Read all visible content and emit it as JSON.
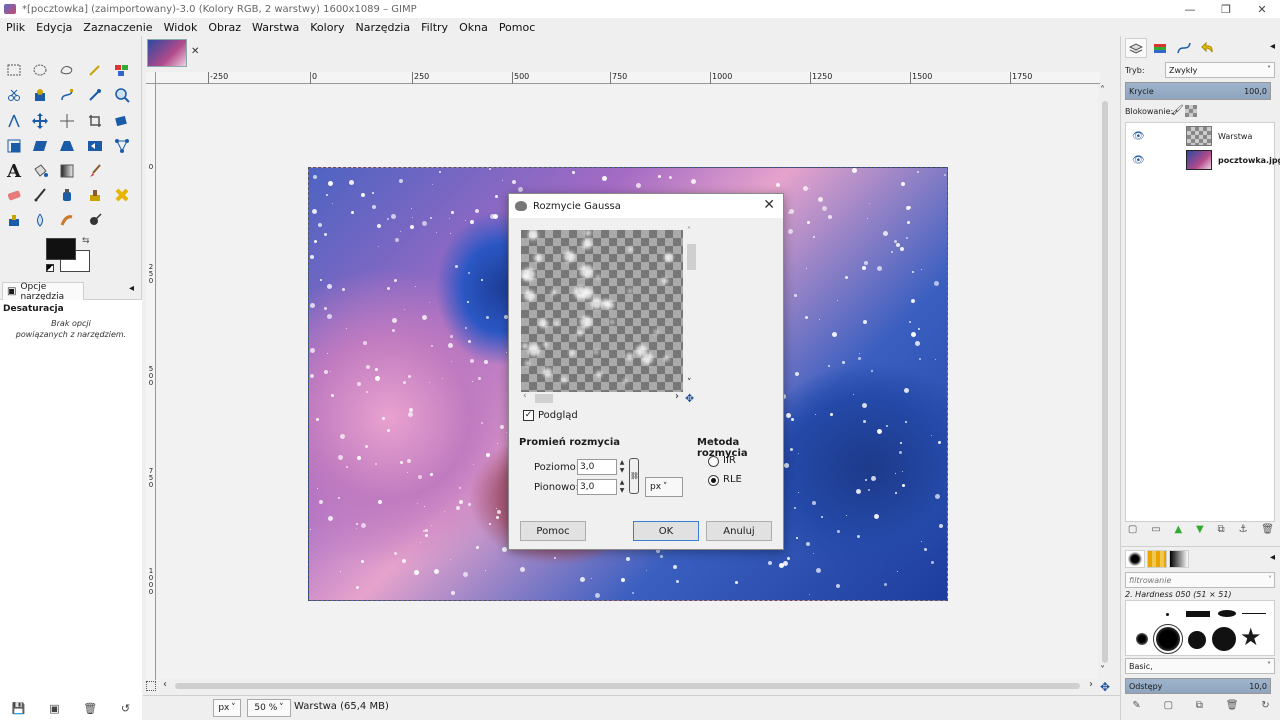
{
  "window": {
    "title": "*[pocztowka] (zaimportowany)-3.0 (Kolory RGB, 2 warstwy) 1600x1089 – GIMP",
    "minimize": "—",
    "maximize": "❐",
    "close": "✕"
  },
  "menubar": [
    "Plik",
    "Edycja",
    "Zaznaczenie",
    "Widok",
    "Obraz",
    "Warstwa",
    "Kolory",
    "Narzędzia",
    "Filtry",
    "Okna",
    "Pomoc"
  ],
  "tooloptions": {
    "tab_label": "Opcje narzędzia",
    "heading": "Desaturacja",
    "note_line1": "Brak opcji",
    "note_line2": "powiązanych z narzędziem."
  },
  "ruler": {
    "h_labels": [
      "-250",
      "0",
      "250",
      "500",
      "750",
      "1000",
      "1250",
      "1500",
      "1750"
    ],
    "v_labels": [
      "0",
      "2 5 0",
      "5 0 0",
      "7 5 0",
      "1 0 0 0"
    ]
  },
  "statusbar": {
    "unit": "px",
    "zoom": "50 %",
    "message": "Warstwa (65,4 MB)"
  },
  "dock": {
    "mode_label": "Tryb:",
    "mode_value": "Zwykły",
    "opacity_label": "Krycie",
    "opacity_value": "100,0",
    "lock_label": "Blokowanie:",
    "layers": [
      {
        "name": "Warstwa",
        "bold": false
      },
      {
        "name": "pocztowka.jpg",
        "bold": true
      }
    ],
    "brush_filter": "filtrowanie",
    "brush_name": "2. Hardness 050 (51 × 51)",
    "brush_preset": "Basic,",
    "spacing_label": "Odstępy",
    "spacing_value": "10,0"
  },
  "dialog": {
    "title": "Rozmycie Gaussa",
    "preview_label": "Podgląd",
    "preview_checked": true,
    "radius_section": "Promień rozmycia",
    "horizontal_label": "Poziomo:",
    "horizontal_value": "3,0",
    "vertical_label": "Pionowo:",
    "vertical_value": "3,0",
    "unit": "px",
    "method_section": "Metoda rozmycia",
    "methods": [
      {
        "label": "IIR",
        "selected": false
      },
      {
        "label": "RLE",
        "selected": true
      }
    ],
    "help_button": "Pomoc",
    "ok_button": "OK",
    "cancel_button": "Anuluj"
  }
}
